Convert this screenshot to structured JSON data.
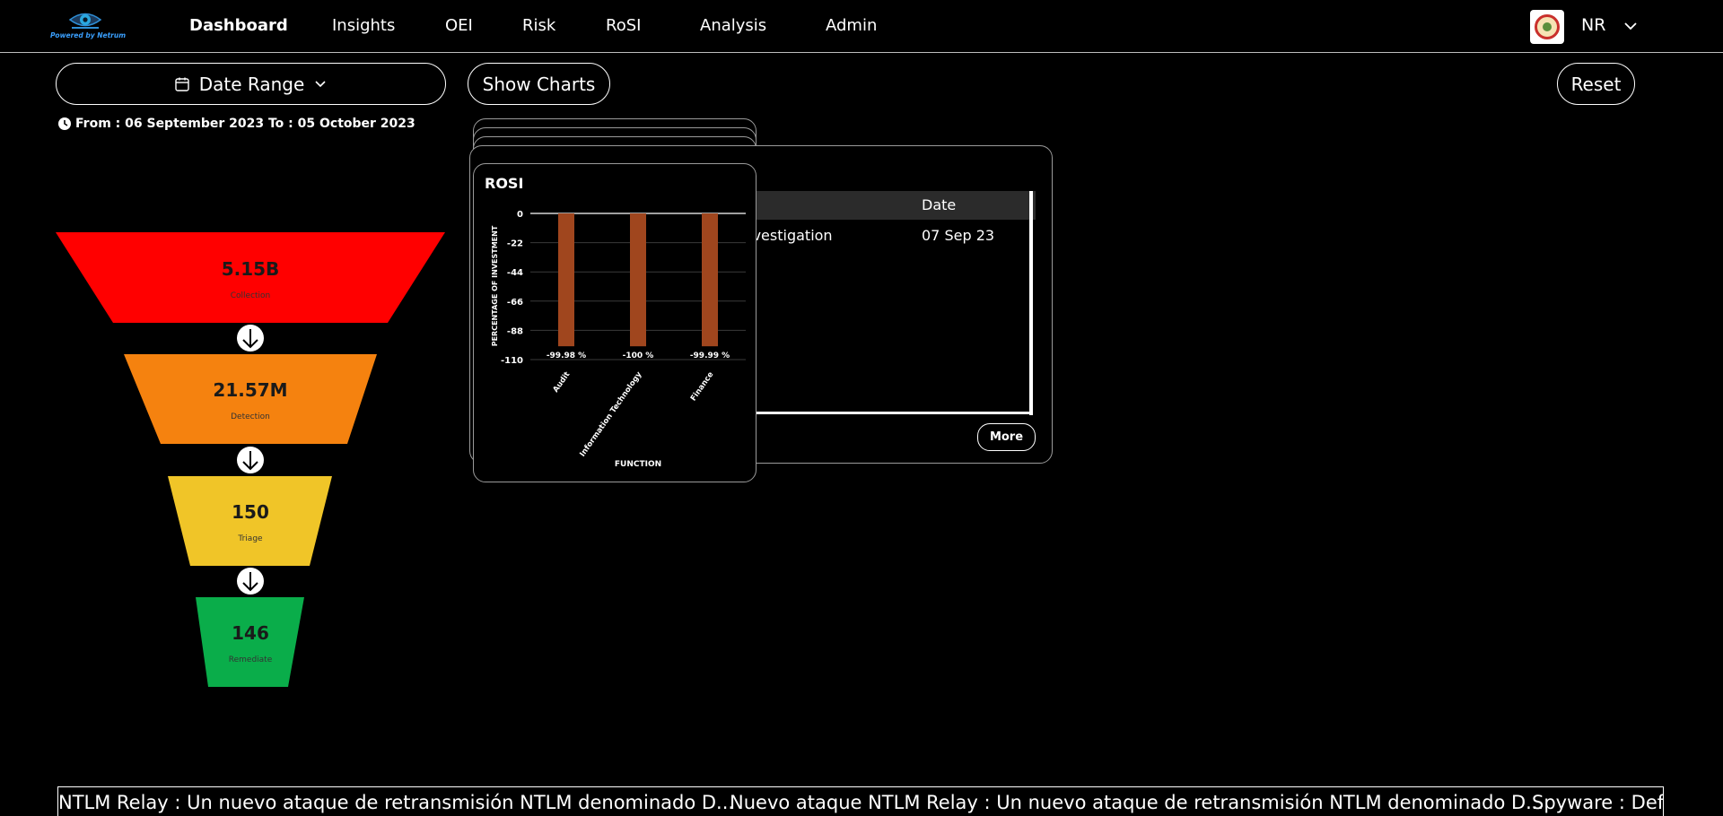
{
  "header": {
    "logo_text": "Powered by Netrum",
    "nav": [
      {
        "label": "Dashboard",
        "active": true
      },
      {
        "label": "Insights"
      },
      {
        "label": "OEI"
      },
      {
        "label": "Risk"
      },
      {
        "label": "RoSI"
      },
      {
        "label": "Analysis"
      },
      {
        "label": "Admin"
      }
    ],
    "user_initials": "NR"
  },
  "controls": {
    "date_range_label": "Date Range",
    "show_charts_label": "Show Charts",
    "reset_label": "Reset",
    "date_text": "From : 06 September 2023 To : 05 October 2023"
  },
  "funnel": [
    {
      "value": "5.15B",
      "label": "Collection",
      "color": "#ff0000"
    },
    {
      "value": "21.57M",
      "label": "Detection",
      "color": "#f5820f"
    },
    {
      "value": "150",
      "label": "Triage",
      "color": "#f0c528"
    },
    {
      "value": "146",
      "label": "Remediate",
      "color": "#0aad4a"
    }
  ],
  "table_card": {
    "columns": [
      "Date"
    ],
    "rows": [
      {
        "description": "investigation",
        "date": "07 Sep 23"
      }
    ],
    "more_label": "More"
  },
  "chart_data": {
    "type": "bar",
    "title": "ROSI",
    "xlabel": "FUNCTION",
    "ylabel": "PERCENTAGE OF INVESTMENT",
    "categories": [
      "Audit",
      "Information Technology",
      "Finance"
    ],
    "values": [
      -99.98,
      -100,
      -99.99
    ],
    "data_labels": [
      "-99.98 %",
      "-100 %",
      "-99.99 %"
    ],
    "yticks": [
      0,
      -22,
      -44,
      -66,
      -88,
      -110
    ],
    "ylim": [
      -110,
      0
    ],
    "bar_color": "#a0461e"
  },
  "ticker": {
    "items": [
      "NTLM Relay : Un nuevo ataque de retransmisión NTLM denominado D...",
      "Nuevo ataque NTLM Relay : Un nuevo ataque de retransmisión NTLM denominado D...",
      "Spyware : Defe"
    ]
  }
}
